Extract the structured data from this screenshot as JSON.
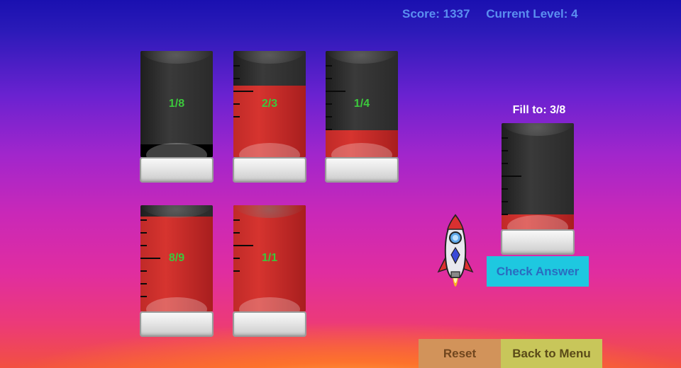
{
  "hud": {
    "score": "Score: 1337",
    "level": "Current Level: 4"
  },
  "cylinders": [
    {
      "label": "1/8",
      "fill_fraction": 0.12,
      "fill_color": "black",
      "ticks": []
    },
    {
      "label": "2/3",
      "fill_fraction": 0.67,
      "fill_color": "red",
      "ticks": [
        "minor",
        "minor",
        "major",
        "minor",
        "minor"
      ]
    },
    {
      "label": "1/4",
      "fill_fraction": 0.25,
      "fill_color": "red",
      "ticks": [
        "minor",
        "minor",
        "major",
        "minor",
        "minor",
        "minor"
      ]
    },
    {
      "label": "8/9",
      "fill_fraction": 0.89,
      "fill_color": "red",
      "ticks": [
        "minor",
        "minor",
        "minor",
        "major",
        "minor",
        "minor",
        "minor"
      ]
    },
    {
      "label": "1/1",
      "fill_fraction": 1.0,
      "fill_color": "red",
      "ticks": [
        "minor",
        "minor",
        "major",
        "minor",
        "minor"
      ]
    }
  ],
  "target": {
    "title": "Fill to: 3/8",
    "fill_fraction": 0.14,
    "fill_color": "red",
    "ticks": [
      "minor",
      "minor",
      "minor",
      "major",
      "minor",
      "minor",
      "minor"
    ]
  },
  "buttons": {
    "check": "Check Answer",
    "reset": "Reset",
    "menu": "Back to Menu"
  },
  "colors": {
    "fill_red": "#c02a28",
    "label_green": "#3cc83c",
    "check_bg": "#1ec8e0",
    "reset_bg": "#d2935a",
    "menu_bg": "#c8c65a"
  },
  "icons": {
    "player": "rocket-icon"
  }
}
